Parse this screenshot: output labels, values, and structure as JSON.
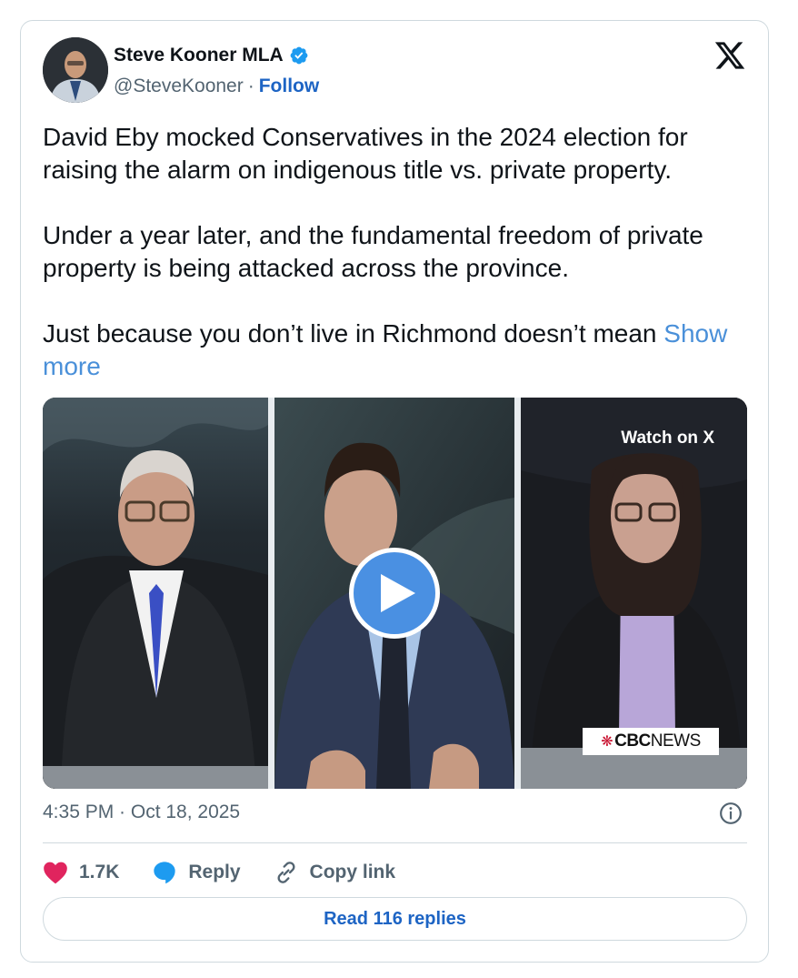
{
  "author": {
    "name": "Steve Kooner MLA",
    "handle": "@SteveKooner",
    "separator": "·",
    "follow_label": "Follow"
  },
  "tweet": {
    "paragraphs": [
      "David Eby mocked Conservatives in the 2024 election for raising the alarm on indigenous title vs. private property.",
      "Under a year later, and the fundamental freedom of private property is being attacked across the province."
    ],
    "last_paragraph": "Just because you don’t live in Richmond doesn’t mean",
    "show_more": "Show more"
  },
  "media": {
    "watch_label": "Watch on X",
    "broadcaster_bold": "CBC",
    "broadcaster_light": "NEWS"
  },
  "timestamp": "4:35 PM · Oct 18, 2025",
  "actions": {
    "likes": "1.7K",
    "reply_label": "Reply",
    "copy_label": "Copy link"
  },
  "read_replies_label": "Read 116 replies",
  "colors": {
    "accent": "#1d64c4",
    "like": "#e0245e",
    "reply": "#1d9bf0",
    "play": "#4a90e2"
  },
  "icons": [
    "verified-badge-icon",
    "x-logo-icon",
    "play-icon",
    "info-icon",
    "heart-icon",
    "reply-bubble-icon",
    "link-icon"
  ]
}
